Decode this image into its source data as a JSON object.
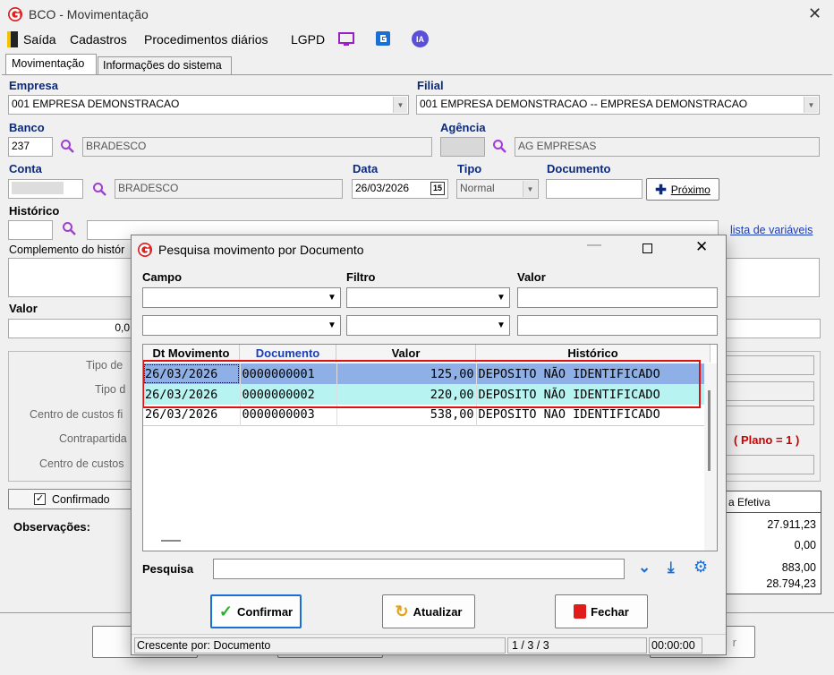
{
  "window": {
    "title": "BCO - Movimentação"
  },
  "menu": {
    "items": [
      "Saída",
      "Cadastros",
      "Procedimentos diários",
      "LGPD"
    ],
    "ia_label": "IA"
  },
  "tabs": [
    "Movimentação",
    "Informações do sistema"
  ],
  "form": {
    "empresa_label": "Empresa",
    "empresa_value": "001 EMPRESA DEMONSTRACAO",
    "filial_label": "Filial",
    "filial_value": "001 EMPRESA DEMONSTRACAO -- EMPRESA DEMONSTRACAO",
    "banco_label": "Banco",
    "banco_code": "237",
    "banco_name": "BRADESCO",
    "agencia_label": "Agência",
    "agencia_name": "AG EMPRESAS",
    "conta_label": "Conta",
    "conta_name": "BRADESCO",
    "data_label": "Data",
    "data_value": "26/03/2026",
    "cal_label": "15",
    "tipo_label": "Tipo",
    "tipo_value": "Normal",
    "documento_label": "Documento",
    "proximo_label": "Próximo",
    "historico_label": "Histórico",
    "lista_variaveis": "lista de variáveis",
    "complemento_label": "Complemento do histór",
    "valor_label": "Valor",
    "valor_value": "0,0",
    "tipo_de_1": "Tipo de",
    "tipo_de_2": "Tipo d",
    "centro_custos_fi": "Centro de custos fi",
    "contrapartida": "Contrapartida",
    "centro_custos": "Centro de custos",
    "plano": "( Plano = 1 )",
    "confirmado_label": "Confirmado",
    "observacoes_label": "Observações:",
    "efetiva_header": "a Efetiva",
    "efetiva_values": [
      "27.911,23",
      "0,00",
      "883,00",
      "28.794,23"
    ],
    "bottom_r": "r"
  },
  "dialog": {
    "title": "Pesquisa movimento por Documento",
    "campo_label": "Campo",
    "filtro_label": "Filtro",
    "valor_label": "Valor",
    "columns": [
      "Dt Movimento",
      "Documento",
      "Valor",
      "Histórico"
    ],
    "rows": [
      {
        "date": "26/03/2026",
        "doc": "0000000001",
        "valor": "125,00",
        "historico": "DEPOSITO NÃO IDENTIFICADO"
      },
      {
        "date": "26/03/2026",
        "doc": "0000000002",
        "valor": "220,00",
        "historico": "DEPOSITO NÃO IDENTIFICADO"
      },
      {
        "date": "26/03/2026",
        "doc": "0000000003",
        "valor": "538,00",
        "historico": "DEPOSITO NÃO IDENTIFICADO"
      }
    ],
    "pesquisa_label": "Pesquisa",
    "confirmar_label": "Confirmar",
    "atualizar_label": "Atualizar",
    "fechar_label": "Fechar",
    "status_sort": "Crescente por: Documento",
    "status_count": "1 / 3 / 3",
    "status_time": "00:00:00"
  },
  "colors": {
    "accent": "#0c2a7c",
    "selected_row": "#8fb0e6",
    "row2": "#b6f3f1",
    "highlight_border": "#d11"
  }
}
